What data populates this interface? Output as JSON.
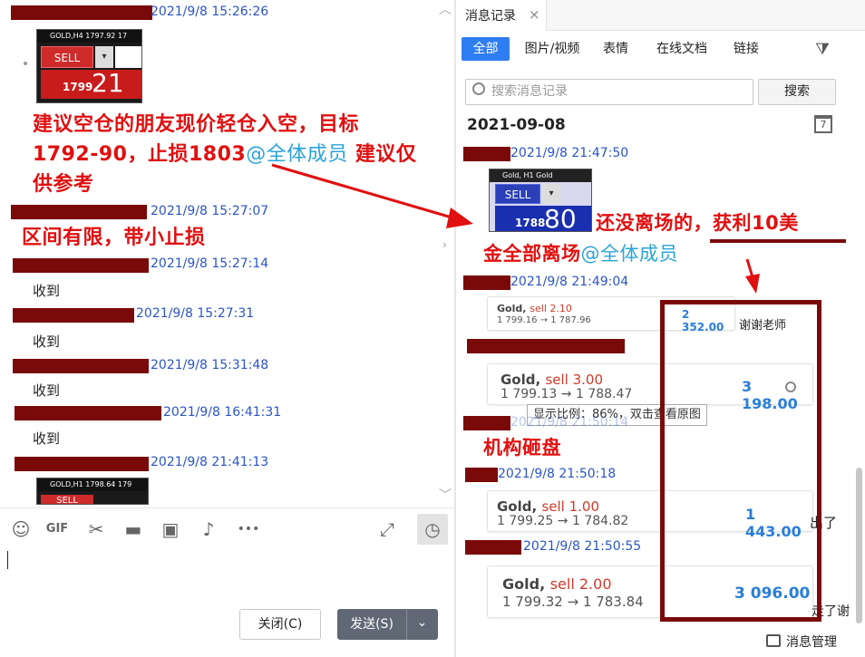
{
  "left": {
    "messages": [
      {
        "time": "2021/9/8 15:26:26"
      },
      {
        "time": "2021/9/8 15:27:07",
        "text": "区间有限，带小止损"
      },
      {
        "time": "2021/9/8 15:27:14",
        "text": "收到"
      },
      {
        "time": "2021/9/8 15:27:31",
        "text": "收到"
      },
      {
        "time": "2021/9/8 15:31:48",
        "text": "收到"
      },
      {
        "time": "2021/9/8 16:41:31",
        "text": "收到"
      },
      {
        "time": "2021/9/8 21:41:13"
      }
    ],
    "thumb1": {
      "bar": "GOLD,H4  1797.92 17",
      "sell": "SELL",
      "price_small": "1799",
      "price_big": "21"
    },
    "thumb2": {
      "bar": "GOLD,H1  1798.64 179",
      "sell": "SELL"
    },
    "advice": {
      "line1": "建议空仓的朋友现价轻仓入空，目标",
      "line2a": "1792-90，止损1803",
      "mention": "@全体成员",
      "line2b": " 建议仅",
      "line3": "供参考"
    },
    "toolbar": {
      "emoji": "☺",
      "gif": "GIF",
      "cut": "✂",
      "folder": "▬",
      "image": "▣",
      "bell": "♪",
      "more": "•••",
      "expand": "⤢",
      "history": "◷"
    },
    "close_label": "关闭(C)",
    "send_label": "发送(S)",
    "send_dropdown": "⌄"
  },
  "right": {
    "tab_title": "消息记录",
    "tab_close": "×",
    "filters": [
      "全部",
      "图片/视频",
      "表情",
      "在线文档",
      "链接"
    ],
    "filter_icon": "⧩",
    "search_placeholder": "搜索消息记录",
    "search_button": "搜索",
    "date": "2021-09-08",
    "calendar_icon": "7",
    "entries": [
      {
        "time": "2021/9/8 21:47:50"
      },
      {
        "time": "2021/9/8 21:49:04"
      },
      {
        "time": "2021/9/8 21:50:14"
      },
      {
        "time": "2021/9/8 21:50:18"
      },
      {
        "time": "2021/9/8 21:50:55"
      }
    ],
    "thumb": {
      "bar": "Gold, H1  Gold",
      "sell": "SELL",
      "price_small": "1788",
      "price_big": "80"
    },
    "notice_line1": "还没离场的，获利10美",
    "notice_line2": "金全部离场",
    "notice_mention": "@全体成员",
    "crash_text": "机构砸盘",
    "thanks_text": "谢谢老师",
    "side_text1": "出了",
    "side_text2": "走了谢",
    "tooltip": "显示比例：86%，双击查看原图",
    "trades": [
      {
        "symbol": "Gold,",
        "side": "sell 2.10",
        "path": "1 799.16 → 1 787.96",
        "profit": "2 352.00"
      },
      {
        "symbol": "Gold,",
        "side": "sell 3.00",
        "path": "1 799.13 → 1 788.47",
        "profit": "3 198.00"
      },
      {
        "symbol": "Gold,",
        "side": "sell 1.00",
        "path": "1 799.25 → 1 784.82",
        "profit": "1 443.00"
      },
      {
        "symbol": "Gold,",
        "side": "sell 2.00",
        "path": "1 799.32 → 1 783.84",
        "profit": "3 096.00"
      }
    ],
    "footer_label": "消息管理"
  },
  "colors": {
    "accent": "#2f7df2",
    "alert_red": "#e01010",
    "redaction": "#7a0a0a",
    "mention": "#2ba3d8",
    "profit_blue": "#2a7ed8"
  }
}
